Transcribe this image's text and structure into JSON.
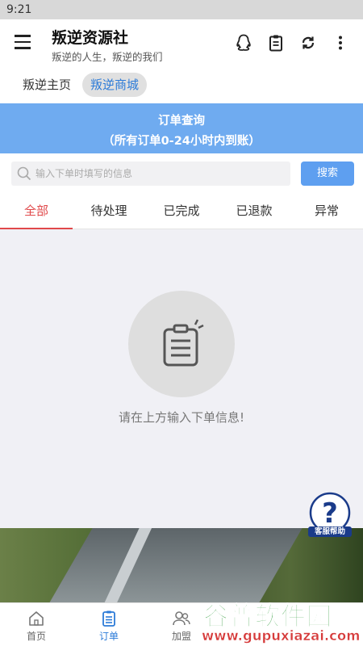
{
  "status_bar": {
    "time": "9:21"
  },
  "app": {
    "title": "叛逆资源社",
    "subtitle": "叛逆的人生，叛逆的我们"
  },
  "nav_tabs": [
    {
      "label": "叛逆主页",
      "active": false
    },
    {
      "label": "叛逆商城",
      "active": true
    }
  ],
  "banner": {
    "line1": "订单查询",
    "line2": "（所有订单0-24小时内到账）"
  },
  "search": {
    "placeholder": "输入下单时填写的信息",
    "button_label": "搜索"
  },
  "order_tabs": [
    {
      "label": "全部",
      "active": true
    },
    {
      "label": "待处理",
      "active": false
    },
    {
      "label": "已完成",
      "active": false
    },
    {
      "label": "已退款",
      "active": false
    },
    {
      "label": "异常",
      "active": false
    }
  ],
  "empty_state": {
    "message": "请在上方输入下单信息!"
  },
  "help": {
    "label": "客服帮助"
  },
  "bottom_nav": [
    {
      "label": "首页",
      "icon": "home-icon",
      "active": false
    },
    {
      "label": "订单",
      "icon": "order-icon",
      "active": true
    },
    {
      "label": "加盟",
      "icon": "users-icon",
      "active": false
    }
  ],
  "watermark": {
    "title": "谷普软件园",
    "url": "www.gupuxiazai.com"
  },
  "colors": {
    "accent": "#2c7bd8",
    "banner": "#6fabf0",
    "active_tab": "#e0484a",
    "search_button": "#5e9ff0"
  }
}
